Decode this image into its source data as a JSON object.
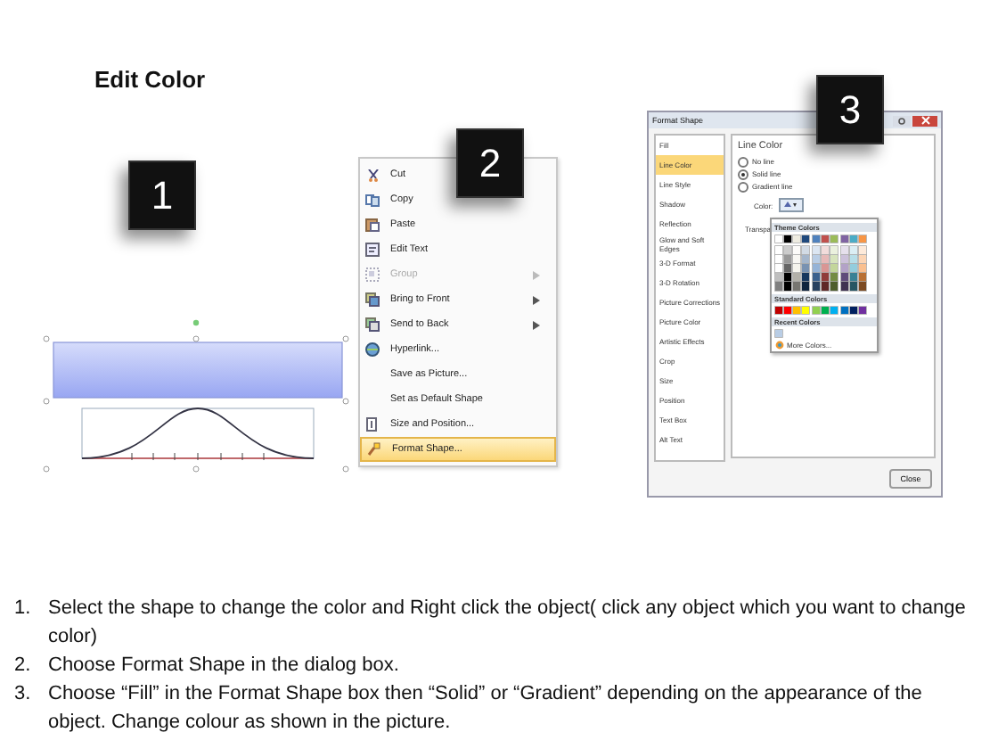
{
  "title": "Edit Color",
  "shape_panel": {
    "badge": "1"
  },
  "context_menu": {
    "badge": "2",
    "items": [
      {
        "label": "Cut",
        "disabled": false,
        "submenu": false,
        "selected": false
      },
      {
        "label": "Copy",
        "disabled": false,
        "submenu": false,
        "selected": false
      },
      {
        "label": "Paste",
        "disabled": false,
        "submenu": false,
        "selected": false
      },
      {
        "label": "Edit Text",
        "disabled": false,
        "submenu": false,
        "selected": false
      },
      {
        "label": "Group",
        "disabled": true,
        "submenu": true,
        "selected": false
      },
      {
        "label": "Bring to Front",
        "disabled": false,
        "submenu": true,
        "selected": false
      },
      {
        "label": "Send to Back",
        "disabled": false,
        "submenu": true,
        "selected": false
      },
      {
        "label": "Hyperlink...",
        "disabled": false,
        "submenu": false,
        "selected": false
      },
      {
        "label": "Save as Picture...",
        "disabled": false,
        "submenu": false,
        "selected": false
      },
      {
        "label": "Set as Default Shape",
        "disabled": false,
        "submenu": false,
        "selected": false
      },
      {
        "label": "Size and Position...",
        "disabled": false,
        "submenu": false,
        "selected": false
      },
      {
        "label": "Format Shape...",
        "disabled": false,
        "submenu": false,
        "selected": true
      }
    ]
  },
  "format_dialog": {
    "badge": "3",
    "title": "Format Shape",
    "categories": [
      {
        "label": "Fill",
        "selected": false
      },
      {
        "label": "Line Color",
        "selected": true
      },
      {
        "label": "Line Style",
        "selected": false
      },
      {
        "label": "Shadow",
        "selected": false
      },
      {
        "label": "Reflection",
        "selected": false
      },
      {
        "label": "Glow and Soft Edges",
        "selected": false
      },
      {
        "label": "3-D Format",
        "selected": false
      },
      {
        "label": "3-D Rotation",
        "selected": false
      },
      {
        "label": "Picture Corrections",
        "selected": false
      },
      {
        "label": "Picture Color",
        "selected": false
      },
      {
        "label": "Artistic Effects",
        "selected": false
      },
      {
        "label": "Crop",
        "selected": false
      },
      {
        "label": "Size",
        "selected": false
      },
      {
        "label": "Position",
        "selected": false
      },
      {
        "label": "Text Box",
        "selected": false
      },
      {
        "label": "Alt Text",
        "selected": false
      }
    ],
    "section_title": "Line Color",
    "options": [
      {
        "label": "No line",
        "selected": false
      },
      {
        "label": "Solid line",
        "selected": true
      },
      {
        "label": "Gradient line",
        "selected": false
      }
    ],
    "color_label": "Color:",
    "transparency_label": "Transpa",
    "theme_title": "Theme Colors",
    "theme_colors": [
      {
        "color": "#ffffff"
      },
      {
        "color": "#000000"
      },
      {
        "color": "#eeece1"
      },
      {
        "color": "#1f497d"
      },
      {
        "color": "#4f81bd"
      },
      {
        "color": "#c0504d"
      },
      {
        "color": "#9bbb59"
      },
      {
        "color": "#8064a2"
      },
      {
        "color": "#4bacc6"
      },
      {
        "color": "#f79646"
      }
    ],
    "standard_title": "Standard Colors",
    "standard_colors": [
      {
        "color": "#c00000"
      },
      {
        "color": "#ff0000"
      },
      {
        "color": "#ffc000"
      },
      {
        "color": "#ffff00"
      },
      {
        "color": "#92d050"
      },
      {
        "color": "#00b050"
      },
      {
        "color": "#00b0f0"
      },
      {
        "color": "#0070c0"
      },
      {
        "color": "#002060"
      },
      {
        "color": "#7030a0"
      }
    ],
    "recent_title": "Recent Colors",
    "recent_colors": [
      {
        "color": "#b9cde5"
      }
    ],
    "more_colors": "More Colors...",
    "close_button": "Close"
  },
  "instructions": [
    {
      "number": "1.",
      "text": "Select the shape to change the color and Right click the object( click any object which you want to change color)"
    },
    {
      "number": "2.",
      "text": "Choose Format Shape in the dialog box."
    },
    {
      "number": "3.",
      "text": "Choose “Fill” in the Format Shape box then “Solid” or “Gradient” depending on the appearance of the object. Change colour as shown in the picture."
    }
  ]
}
